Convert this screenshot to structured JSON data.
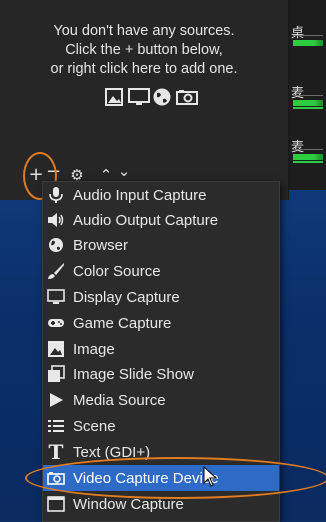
{
  "sources_panel": {
    "empty_line1": "You don't have any sources.",
    "empty_line2": "Click the + button below,",
    "empty_line3": "or right click here to add one.",
    "icons": [
      "image-icon",
      "display-icon",
      "browser-icon",
      "camera-icon"
    ]
  },
  "toolbar": {
    "add": "+",
    "remove": "−",
    "settings": "⚙",
    "up": "⌃",
    "down": "⌄"
  },
  "mixer_strip": {
    "rows": [
      {
        "glyph": "桌"
      },
      {
        "glyph": "麦"
      },
      {
        "glyph": "麦"
      }
    ]
  },
  "menu": {
    "items": [
      {
        "label": "Audio Input Capture",
        "icon": "microphone-icon"
      },
      {
        "label": "Audio Output Capture",
        "icon": "speaker-icon"
      },
      {
        "label": "Browser",
        "icon": "globe-icon"
      },
      {
        "label": "Color Source",
        "icon": "brush-icon"
      },
      {
        "label": "Display Capture",
        "icon": "monitor-icon"
      },
      {
        "label": "Game Capture",
        "icon": "gamepad-icon"
      },
      {
        "label": "Image",
        "icon": "image-icon"
      },
      {
        "label": "Image Slide Show",
        "icon": "slideshow-icon"
      },
      {
        "label": "Media Source",
        "icon": "play-icon"
      },
      {
        "label": "Scene",
        "icon": "list-icon"
      },
      {
        "label": "Text (GDI+)",
        "icon": "text-icon"
      },
      {
        "label": "Video Capture Device",
        "icon": "camera-icon",
        "selected": true
      },
      {
        "label": "Window Capture",
        "icon": "window-icon"
      }
    ]
  },
  "colors": {
    "panel_bg": "#262626",
    "menu_bg": "#2b2b2b",
    "selection": "#2d6bc7",
    "annotation": "#e07b22",
    "meter_green": "#2ecc40"
  }
}
